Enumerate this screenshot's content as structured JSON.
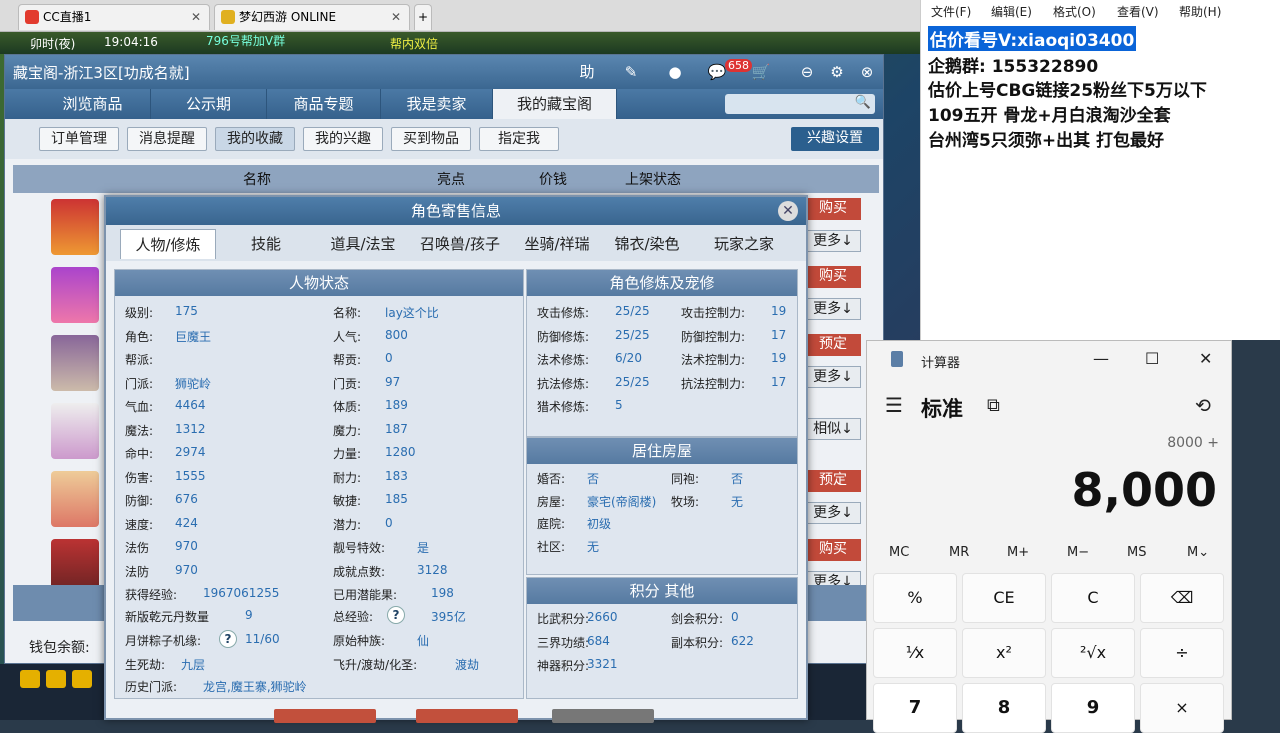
{
  "browser_tabs": [
    {
      "label": "CC直播1"
    },
    {
      "label": "梦幻西游 ONLINE"
    }
  ],
  "game_bar": {
    "time_label": "卯时(夜)",
    "clock": "19:04:16",
    "ticker": "796号帮加V群",
    "ticker2": "帮内双倍"
  },
  "cbg": {
    "title": "藏宝阁-浙江3区[功成名就]",
    "header_icons": [
      "助",
      "edit-icon",
      "stop-icon",
      "chat-icon",
      "cart-icon",
      "minimize-icon",
      "settings-icon",
      "close-icon"
    ],
    "badge": "658",
    "nav_tabs": [
      "浏览商品",
      "公示期",
      "商品专题",
      "我是卖家",
      "我的藏宝阁"
    ],
    "sub_buttons": [
      "订单管理",
      "消息提醒",
      "我的收藏",
      "我的兴趣",
      "买到物品",
      "指定我"
    ],
    "interest_settings": "兴趣设置",
    "columns": [
      "名称",
      "亮点",
      "价钱",
      "上架状态"
    ],
    "row_actions": [
      [
        "购买",
        "更多↓"
      ],
      [
        "购买",
        "更多↓"
      ],
      [
        "预定",
        "更多↓"
      ],
      [
        "相似↓"
      ],
      [
        "预定",
        "更多↓"
      ],
      [
        "购买",
        "更多↓"
      ]
    ],
    "wallet_label": "钱包余额:"
  },
  "dialog": {
    "title": "角色寄售信息",
    "tabs": [
      "人物/修炼",
      "技能",
      "道具/法宝",
      "召唤兽/孩子",
      "坐骑/祥瑞",
      "锦衣/染色",
      "玩家之家"
    ],
    "status_title": "人物状态",
    "left_col": [
      {
        "k": "级别:",
        "v": "175"
      },
      {
        "k": "角色:",
        "v": "巨魔王"
      },
      {
        "k": "帮派:",
        "v": ""
      },
      {
        "k": "门派:",
        "v": "狮驼岭"
      },
      {
        "k": "气血:",
        "v": "4464"
      },
      {
        "k": "魔法:",
        "v": "1312"
      },
      {
        "k": "命中:",
        "v": "2974"
      },
      {
        "k": "伤害:",
        "v": "1555"
      },
      {
        "k": "防御:",
        "v": "676"
      },
      {
        "k": "速度:",
        "v": "424"
      },
      {
        "k": "法伤",
        "v": "970"
      },
      {
        "k": "法防",
        "v": "970"
      }
    ],
    "mid_col": [
      {
        "k": "名称:",
        "v": "lay这个比"
      },
      {
        "k": "人气:",
        "v": "800"
      },
      {
        "k": "帮贡:",
        "v": "0"
      },
      {
        "k": "门贡:",
        "v": "97"
      },
      {
        "k": "体质:",
        "v": "189"
      },
      {
        "k": "魔力:",
        "v": "187"
      },
      {
        "k": "力量:",
        "v": "1280"
      },
      {
        "k": "耐力:",
        "v": "183"
      },
      {
        "k": "敏捷:",
        "v": "185"
      },
      {
        "k": "潜力:",
        "v": "0"
      },
      {
        "k": "靓号特效:",
        "v": "是"
      },
      {
        "k": "成就点数:",
        "v": "3128"
      }
    ],
    "extra": {
      "exp_k": "获得经验:",
      "exp_v": "1967061255",
      "pot_k": "已用潜能果:",
      "pot_v": "198",
      "qkd_k": "新版乾元丹数量",
      "qkd_v": "9",
      "total_k": "总经验:",
      "total_v": "395亿",
      "moon_k": "月饼粽子机缘:",
      "moon_v": "11/60",
      "race_k": "原始种族:",
      "race_v": "仙",
      "life_k": "生死劫:",
      "life_v": "九层",
      "fly_k": "飞升/渡劫/化圣:",
      "fly_v": "渡劫",
      "hist_k": "历史门派:",
      "hist_v": "龙宫,魔王寨,狮驼岭",
      "q": "?"
    },
    "cult_title": "角色修炼及宠修",
    "cult": [
      {
        "k1": "攻击修炼:",
        "v1": "25/25",
        "k2": "攻击控制力:",
        "v2": "19"
      },
      {
        "k1": "防御修炼:",
        "v1": "25/25",
        "k2": "防御控制力:",
        "v2": "17"
      },
      {
        "k1": "法术修炼:",
        "v1": "6/20",
        "k2": "法术控制力:",
        "v2": "19"
      },
      {
        "k1": "抗法修炼:",
        "v1": "25/25",
        "k2": "抗法控制力:",
        "v2": "17"
      },
      {
        "k1": "猎术修炼:",
        "v1": "5",
        "k2": "",
        "v2": ""
      }
    ],
    "house_title": "居住房屋",
    "house": [
      {
        "k1": "婚否:",
        "v1": "否",
        "k2": "同袍:",
        "v2": "否"
      },
      {
        "k1": "房屋:",
        "v1": "豪宅(帝阁楼)",
        "k2": "牧场:",
        "v2": "无"
      },
      {
        "k1": "庭院:",
        "v1": "初级",
        "k2": "",
        "v2": ""
      },
      {
        "k1": "社区:",
        "v1": "无",
        "k2": "",
        "v2": ""
      }
    ],
    "points_title": "积分 其他",
    "points": [
      {
        "k1": "比武积分:",
        "v1": "2660",
        "k2": "剑会积分:",
        "v2": "0"
      },
      {
        "k1": "三界功绩:",
        "v1": "684",
        "k2": "副本积分:",
        "v2": "622"
      },
      {
        "k1": "神器积分:",
        "v1": "3321",
        "k2": "",
        "v2": ""
      }
    ]
  },
  "notepad": {
    "menu": [
      "文件(F)",
      "编辑(E)",
      "格式(O)",
      "查看(V)",
      "帮助(H)"
    ],
    "lines": [
      "估价看号V:xiaoqi03400",
      "企鹅群: 155322890",
      "估价上号CBG链接25粉丝下5万以下",
      "109五开 骨龙+月白浪淘沙全套",
      "台州湾5只须弥+出其 打包最好"
    ]
  },
  "calculator": {
    "title": "计算器",
    "mode": "标准",
    "expression": "8000 +",
    "display": "8,000",
    "memory": [
      "MC",
      "MR",
      "M+",
      "M−",
      "MS",
      "M⌄"
    ],
    "keys": [
      [
        "%",
        "CE",
        "C",
        "⌫"
      ],
      [
        "¹⁄x",
        "x²",
        "²√x",
        "÷"
      ],
      [
        "7",
        "8",
        "9",
        "×"
      ]
    ],
    "colors": {
      "accent": "#2b5f8e",
      "buy": "#c24a3a",
      "value": "#2a6db0"
    }
  }
}
